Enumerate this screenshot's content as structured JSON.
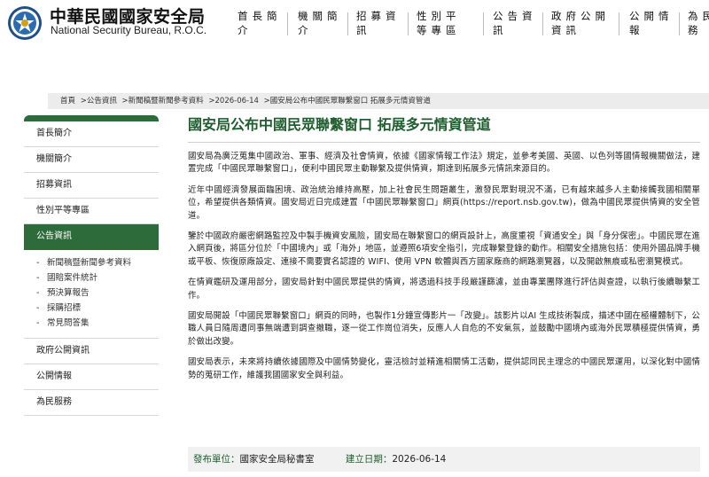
{
  "header": {
    "title_zh": "中華民國國家安全局",
    "title_en": "National Security Bureau, R.O.C.",
    "nav": [
      {
        "label": "首長簡介"
      },
      {
        "label": "機關簡介"
      },
      {
        "label": "招募資訊"
      },
      {
        "label": "性別平等專區"
      },
      {
        "label": "公告資訊"
      },
      {
        "label": "政府公開資訊"
      },
      {
        "label": "公開情報"
      },
      {
        "label": "為民服務"
      }
    ]
  },
  "breadcrumb": [
    "首頁",
    ">公告資訊",
    ">新聞稿暨新聞參考資料",
    ">2026-06-14",
    ">國安局公布中國民眾聯繫窗口 拓展多元情資管道"
  ],
  "sidebar": {
    "items_top": [
      {
        "label": "首長簡介"
      },
      {
        "label": "機關簡介"
      },
      {
        "label": "招募資訊"
      },
      {
        "label": "性別平等專區"
      },
      {
        "label": "公告資訊"
      }
    ],
    "sub_items": [
      {
        "dash": "-",
        "label": "新聞稿暨新聞參考資料"
      },
      {
        "dash": "-",
        "label": "國賠案件統計"
      },
      {
        "dash": "-",
        "label": "預決算報告"
      },
      {
        "dash": "-",
        "label": "採購招標"
      },
      {
        "dash": "-",
        "label": "常見問答集"
      }
    ],
    "items_bottom": [
      {
        "label": "政府公開資訊"
      },
      {
        "label": "公開情報"
      },
      {
        "label": "為民服務"
      }
    ]
  },
  "article": {
    "title": "國安局公布中國民眾聯繫窗口 拓展多元情資管道",
    "paragraphs": [
      "國安局為廣泛蒐集中國政治、軍事、經濟及社會情資，依據《國家情報工作法》規定，並參考美國、英國、以色列等國情報機關做法，建置完成「中國民眾聯繫窗口」，便利中國民眾主動聯繫及提供情資，期達到拓展多元情訊來源目的。",
      "近年中國經濟發展面臨困境、政治統治維持高壓，加上社會民生問題叢生，激發民眾對現況不滿，已有越來越多人主動接觸我國相關單位，希望提供各類情資。國安局近日完成建置「中國民眾聯繫窗口」網頁(https://report.nsb.gov.tw)，做為中國民眾提供情資的安全管道。",
      "鑒於中國政府嚴密網路監控及中製手機資安風險，國安局在聯繫窗口的網頁設計上，高度重視「資通安全」與「身分保密」。中國民眾在進入網頁後，將區分位於「中國境內」或「海外」地區，並遵照6項安全指引，完成聯繫登錄的動作。相關安全措施包括：使用外國品牌手機或平板、恢復原廠設定、連接不需要實名認證的 WIFI、使用 VPN 軟體與西方國家廠商的網路瀏覽器，以及開啟無痕或私密瀏覽模式。",
      "在情資鑑研及運用部分，國安局針對中國民眾提供的情資，將透過科技手段嚴謹篩濾，並由專業團隊進行評估與查證，以執行後續聯繫工作。",
      "國安局開設「中國民眾聯繫窗口」網頁的同時，也製作1分鐘宣傳影片一「改變」。該影片以AI 生成技術製成，描述中國在極權體制下，公職人員日隨周遭同事無端遭到調查撤職，逐一從工作崗位消失，反應人人自危的不安氣氛，並鼓勵中國境內或海外民眾積極提供情資，勇於做出改變。",
      "國安局表示，未來將持續依據國際及中國情勢變化，靈活檢討並精進相關情工活動，提供認同民主理念的中國民眾運用，以深化對中國情勢的蒐研工作，維護我國國家安全與利益。"
    ],
    "publisher_label": "發布單位：",
    "publisher": "國家安全局秘書室",
    "date_label": "建立日期：",
    "date": "2026-06-14"
  },
  "colors": {
    "brand_green": "#2e6b3a",
    "title_green": "#1f5e2f",
    "breadcrumb_bg": "#ececec"
  },
  "icons": {
    "logo": "nsb-emblem-icon"
  }
}
